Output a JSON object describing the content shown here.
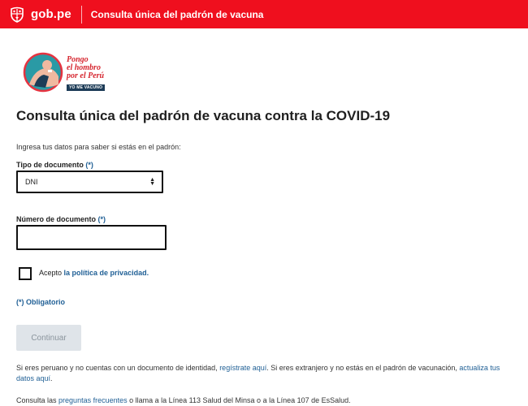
{
  "header": {
    "brand": "gob.pe",
    "title": "Consulta única del padrón de vacuna",
    "bg_color": "#ef0f1e"
  },
  "campaign": {
    "slogan_line1": "Pongo",
    "slogan_line2": "el hombro",
    "slogan_line3": "por el Perú",
    "tag": "YO ME VACUNO"
  },
  "main": {
    "title": "Consulta única del padrón de vacuna contra la COVID-19",
    "intro": "Ingresa tus datos para saber si estás en el padrón:",
    "doc_type_label": "Tipo de documento",
    "doc_type_required": "(*)",
    "doc_type_value": "DNI",
    "doc_number_label": "Número de documento",
    "doc_number_required": "(*)",
    "doc_number_value": "",
    "accept_text": "Acepto",
    "privacy_link": "la política de privacidad.",
    "mandatory_note": "(*) Obligatorio",
    "submit_label": "Continuar"
  },
  "footer": {
    "p1_a": "Si eres peruano y no cuentas con un documento de identidad,",
    "p1_link1": "regístrate aquí",
    "p1_b": ". Si eres extranjero y no estás en el padrón de vacunación,",
    "p1_link2": "actualiza tus datos aquí",
    "p1_c": ".",
    "p2_a": "Consulta las",
    "p2_link": "preguntas frecuentes",
    "p2_b": "o llama a la Línea 113 Salud del Minsa o a la Línea 107 de EsSalud."
  },
  "colors": {
    "link": "#1f5f95",
    "button_bg": "#dfe4e9",
    "button_text": "#8a949c"
  }
}
